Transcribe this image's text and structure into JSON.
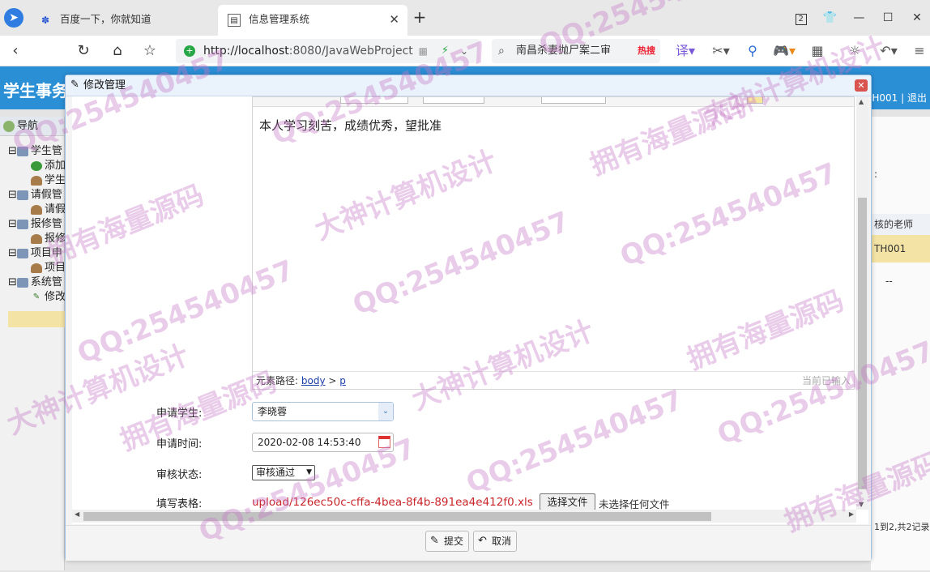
{
  "browser": {
    "tabs": [
      {
        "title": "百度一下，你就知道",
        "active": false,
        "favicon": "baidu-paw-icon"
      },
      {
        "title": "信息管理系统",
        "active": true,
        "favicon": "page-icon"
      }
    ],
    "tab_count": "2",
    "address": {
      "host": "http://localhost",
      "rest": ":8080/JavaWebProject"
    },
    "search": {
      "text": "南昌杀妻抛尸案二审",
      "badge": "热搜"
    }
  },
  "app": {
    "title": "学生事务",
    "user_info": "H001 | 退出",
    "nav_title": "导航",
    "tree": [
      {
        "label": "学生管",
        "icon": "computer-icon"
      },
      {
        "label": "添加",
        "icon": "add-icon"
      },
      {
        "label": "学生",
        "icon": "user-icon"
      },
      {
        "label": "请假管",
        "icon": "computer-icon"
      },
      {
        "label": "请假",
        "icon": "user-icon"
      },
      {
        "label": "报修管",
        "icon": "computer-icon"
      },
      {
        "label": "报修",
        "icon": "user-icon"
      },
      {
        "label": "项目申",
        "icon": "computer-icon"
      },
      {
        "label": "项目",
        "icon": "user-icon"
      },
      {
        "label": "系统管",
        "icon": "computer-icon"
      },
      {
        "label": "修改",
        "icon": "pencil-icon"
      }
    ],
    "right_col": {
      "colon": ":",
      "header": "核的老师",
      "cell1": "TH001",
      "cell2": "--",
      "pager": "1到2,共2记录"
    }
  },
  "dialog": {
    "title": "修改管理",
    "editor": {
      "content": "本人学习刻苦，成绩优秀，望批准",
      "path_label": "元素路径:",
      "path_body": "body",
      "path_sep": " > ",
      "path_p": "p",
      "status": "当前已输入"
    },
    "fields": {
      "student_label": "申请学生:",
      "student_value": "李晓蓉",
      "time_label": "申请时间:",
      "time_value": "2020-02-08 14:53:40",
      "status_label": "审核状态:",
      "status_value": "审核通过",
      "file_label": "填写表格:",
      "file_link": "upload/126ec50c-cffa-4bea-8f4b-891ea4e412f0.xls",
      "file_button": "选择文件",
      "file_none": "未选择任何文件"
    },
    "buttons": {
      "submit": "提交",
      "cancel": "取消"
    }
  },
  "watermark": {
    "qq": "QQ:254540457",
    "source": "拥有海量源码",
    "design": "大神计算机设计"
  }
}
